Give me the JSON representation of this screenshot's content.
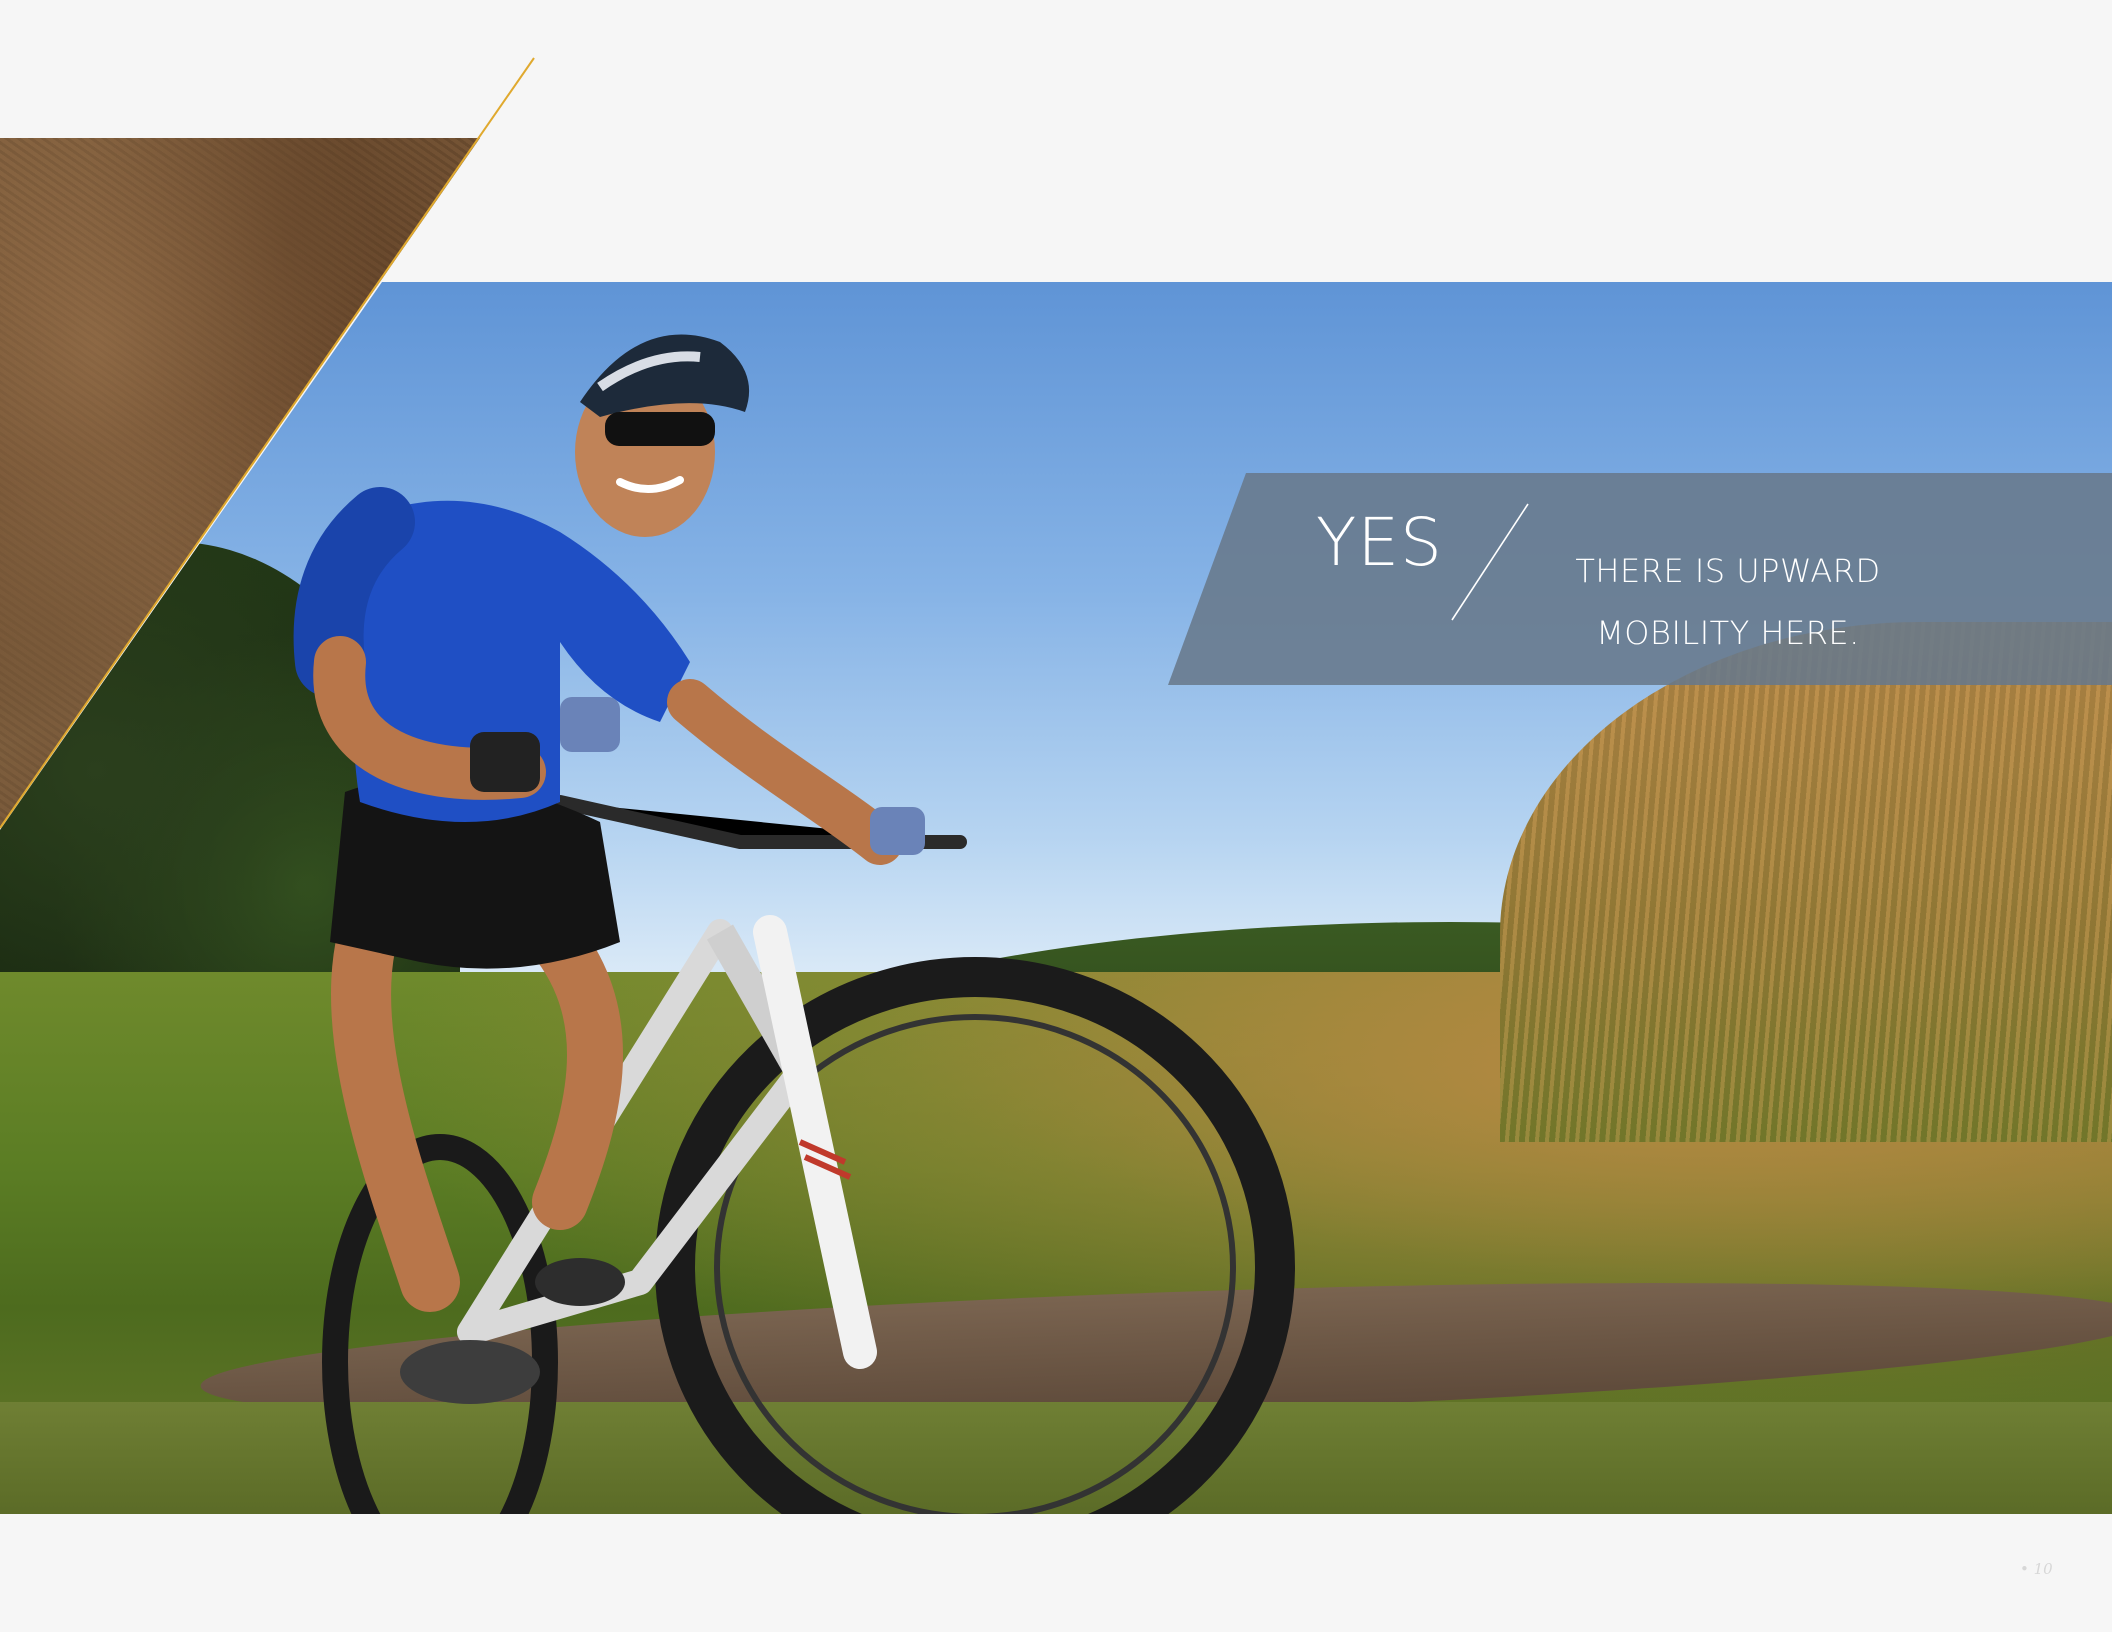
{
  "banner": {
    "headline": "YES",
    "line1": "THERE IS UPWARD",
    "line2": "MOBILITY HERE."
  },
  "footer": {
    "page_number": "• 10"
  },
  "colors": {
    "background": "#f6f6f6",
    "accent_line": "#e0a92e",
    "banner": "#68798b",
    "text": "#ffffff"
  },
  "images": {
    "rock_texture": "brown rock texture",
    "photo": "cyclist riding a mountain bike on a dirt trail through a grassy field"
  }
}
